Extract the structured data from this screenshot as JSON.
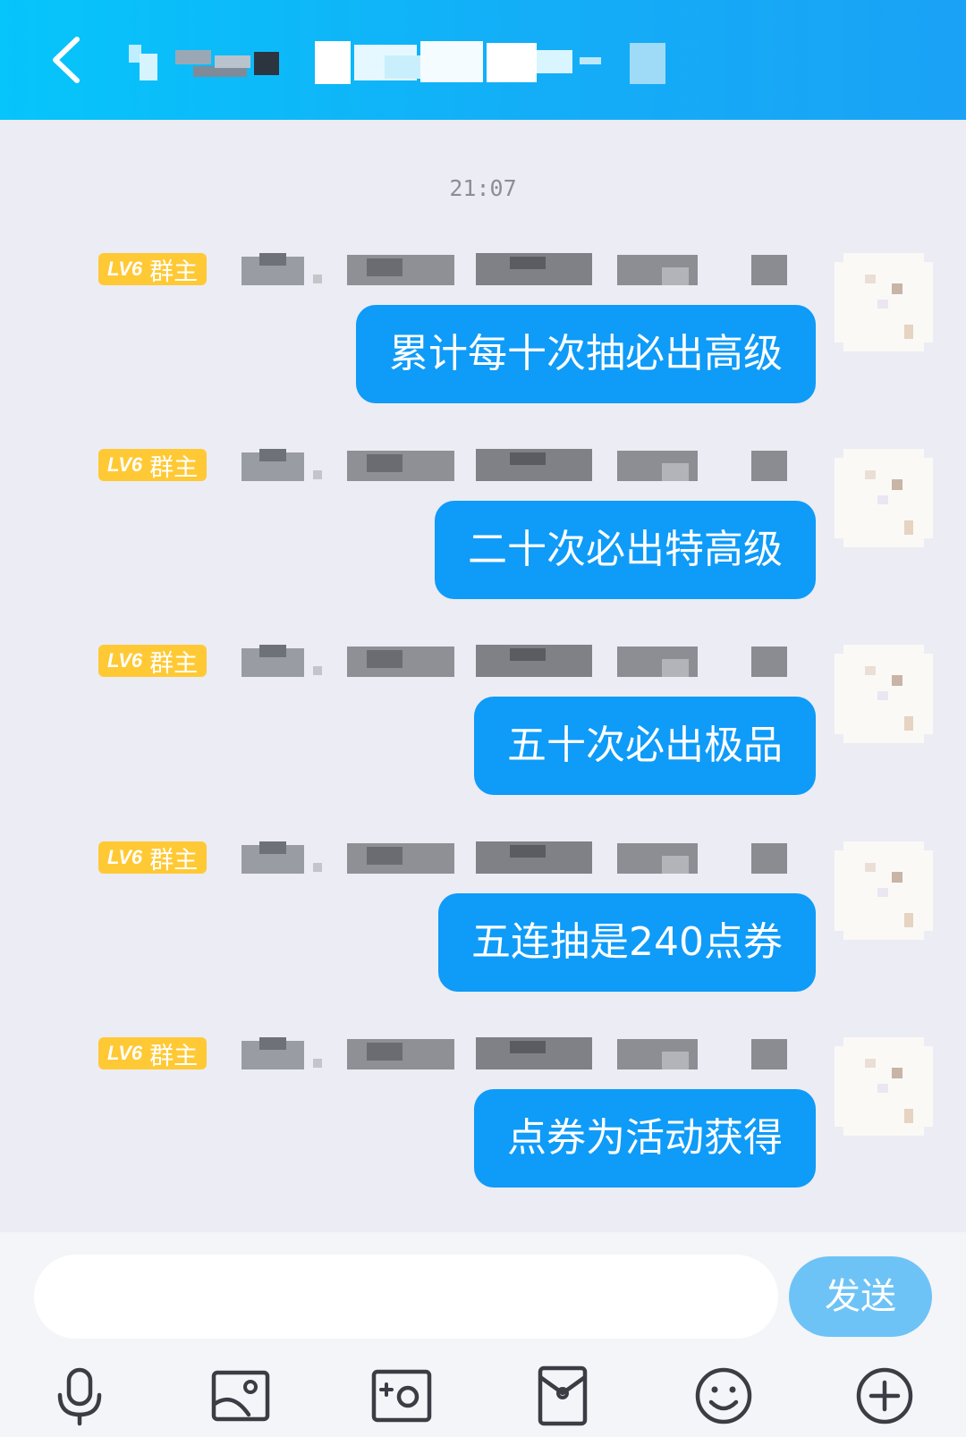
{
  "time_divider": "21:07",
  "messages": [
    {
      "badge_lv": "LV6",
      "badge_role": "群主",
      "text": "累计每十次抽必出高级"
    },
    {
      "badge_lv": "LV6",
      "badge_role": "群主",
      "text": "二十次必出特高级"
    },
    {
      "badge_lv": "LV6",
      "badge_role": "群主",
      "text": "五十次必出极品"
    },
    {
      "badge_lv": "LV6",
      "badge_role": "群主",
      "text": "五连抽是240点券"
    },
    {
      "badge_lv": "LV6",
      "badge_role": "群主",
      "text": "点券为活动获得"
    }
  ],
  "composer": {
    "input_value": "",
    "send_label": "发送"
  },
  "colors": {
    "header": "#13aef7",
    "bubble": "#0f9bf8",
    "badge": "#ffc935",
    "send": "#6ec3f6",
    "background": "#ececf4"
  },
  "toolbar_icons": [
    "microphone-icon",
    "image-icon",
    "camera-icon",
    "red-packet-icon",
    "emoji-icon",
    "plus-icon"
  ]
}
